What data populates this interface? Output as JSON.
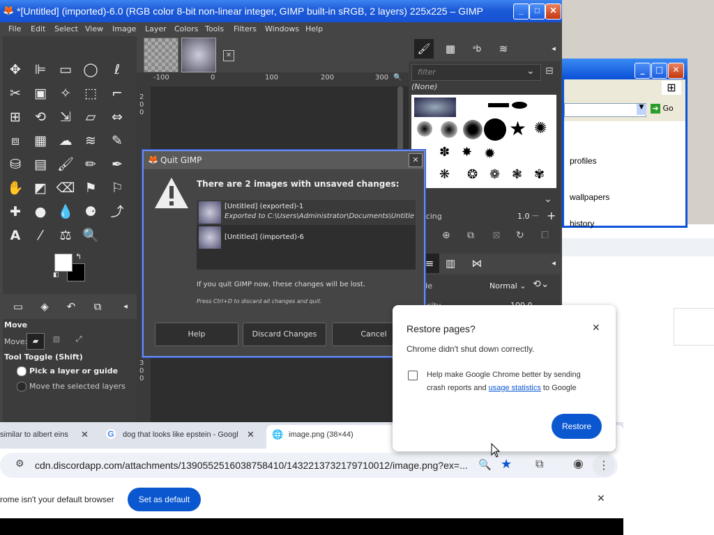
{
  "gimp": {
    "title": "*[Untitled] (imported)-6.0 (RGB color 8-bit non-linear integer, GIMP built-in sRGB, 2 layers) 225x225 – GIMP",
    "menu": [
      "File",
      "Edit",
      "Select",
      "View",
      "Image",
      "Layer",
      "Colors",
      "Tools",
      "Filters",
      "Windows",
      "Help"
    ],
    "ruler_labels": [
      "-100",
      "0",
      "100",
      "200",
      "300"
    ],
    "vruler_labels": [
      "2",
      "0",
      "0"
    ],
    "vruler_bottom": [
      "3",
      "0",
      "0"
    ],
    "tool_options": {
      "title": "Move",
      "move_label": "Move:",
      "toggle_label": "Tool Toggle  (Shift)",
      "option1": "Pick a layer or guide",
      "option2": "Move the selected layers"
    },
    "brushes": {
      "filter_placeholder": "filter",
      "selected": "(None)",
      "spacing_label": "Spacing",
      "spacing_value": "1.0"
    },
    "layers": {
      "mode_label": "Mode",
      "mode_value": "Normal",
      "opacity_label": "Opacity",
      "opacity_value": "100.0"
    }
  },
  "quit_dialog": {
    "title": "Quit GIMP",
    "heading": "There are 2 images with unsaved changes:",
    "images": [
      {
        "name": "[Untitled] (exported)-1",
        "detail": "Exported to C:\\Users\\Administrator\\Documents\\Untitled.p"
      },
      {
        "name": "[Untitled] (imported)-6",
        "detail": ""
      }
    ],
    "warning": "If you quit GIMP now, these changes will be lost.",
    "hint": "Press Ctrl+D to discard all changes and quit.",
    "buttons": {
      "help": "Help",
      "discard": "Discard Changes",
      "cancel": "Cancel"
    }
  },
  "explorer": {
    "go": "Go",
    "items": [
      "profiles",
      "wallpapers",
      "history"
    ]
  },
  "chrome": {
    "tabs": [
      {
        "title": "similar to albert eins"
      },
      {
        "title": "dog that looks like epstein - Googl"
      },
      {
        "title": "image.png (38×44)"
      }
    ],
    "url": "cdn.discordapp.com/attachments/1390552516038758410/1432213732179710012/image.png?ex=...",
    "infobar_text": "rome isn't your default browser",
    "set_default": "Set as default"
  },
  "restore_popup": {
    "title": "Restore pages?",
    "message": "Chrome didn't shut down correctly.",
    "checkbox_text_1": "Help make Google Chrome better by sending",
    "checkbox_text_2a": "crash reports and ",
    "checkbox_link": "usage statistics",
    "checkbox_text_2b": " to Google",
    "restore_button": "Restore"
  },
  "colors": {
    "xp_blue": "#1c5ad8",
    "gimp_dark": "#454545",
    "chrome_blue": "#0b57d0"
  }
}
